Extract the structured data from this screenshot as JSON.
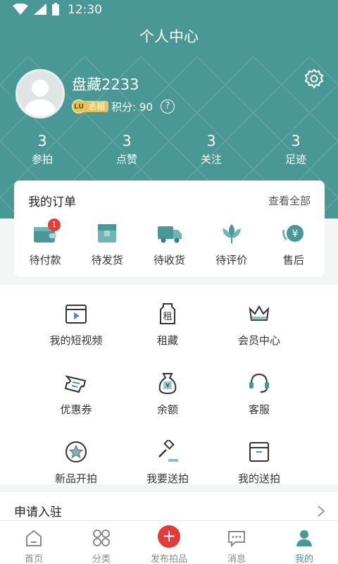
{
  "status_bar": {
    "time": "12:30"
  },
  "nav": {
    "title": "个人中心"
  },
  "profile": {
    "username": "盘藏2233",
    "level": "LU",
    "rank": "丞相",
    "points": "积分: 90",
    "help": "?"
  },
  "stats": [
    {
      "value": "3",
      "label": "参拍"
    },
    {
      "value": "3",
      "label": "点赞"
    },
    {
      "value": "3",
      "label": "关注"
    },
    {
      "value": "3",
      "label": "足迹"
    }
  ],
  "orders": {
    "title": "我的订单",
    "view_all": "查看全部",
    "items": [
      {
        "label": "待付款",
        "icon": "wallet-icon",
        "badge": "1"
      },
      {
        "label": "待发货",
        "icon": "package-icon"
      },
      {
        "label": "待收货",
        "icon": "truck-icon"
      },
      {
        "label": "待评价",
        "icon": "lotus-icon"
      },
      {
        "label": "售后",
        "icon": "yuan-refund-icon",
        "yuan": "¥"
      }
    ]
  },
  "services": [
    {
      "label": "我的短视频",
      "icon": "video-icon"
    },
    {
      "label": "租藏",
      "icon": "rent-jar-icon",
      "glyph": "租"
    },
    {
      "label": "会员中心",
      "icon": "crown-icon"
    },
    {
      "label": "优惠券",
      "icon": "coupon-icon"
    },
    {
      "label": "余额",
      "icon": "money-bag-icon",
      "yuan": "¥"
    },
    {
      "label": "客服",
      "icon": "headset-icon"
    },
    {
      "label": "新品开拍",
      "icon": "star-badge-icon"
    },
    {
      "label": "我要送拍",
      "icon": "gavel-icon"
    },
    {
      "label": "我的送拍",
      "icon": "box-icon"
    }
  ],
  "apply": {
    "label": "申请入驻"
  },
  "tabbar": [
    {
      "label": "首页",
      "icon": "home-icon"
    },
    {
      "label": "分类",
      "icon": "category-icon"
    },
    {
      "label": "发布拍品",
      "icon": "plus-icon",
      "plus": "+"
    },
    {
      "label": "消息",
      "icon": "message-icon"
    },
    {
      "label": "我的",
      "icon": "user-icon",
      "active": true
    }
  ],
  "colors": {
    "primary": "#4a9896",
    "badge": "#e93b3b",
    "gold": "#e7c25d",
    "publish": "#e33a3a"
  }
}
